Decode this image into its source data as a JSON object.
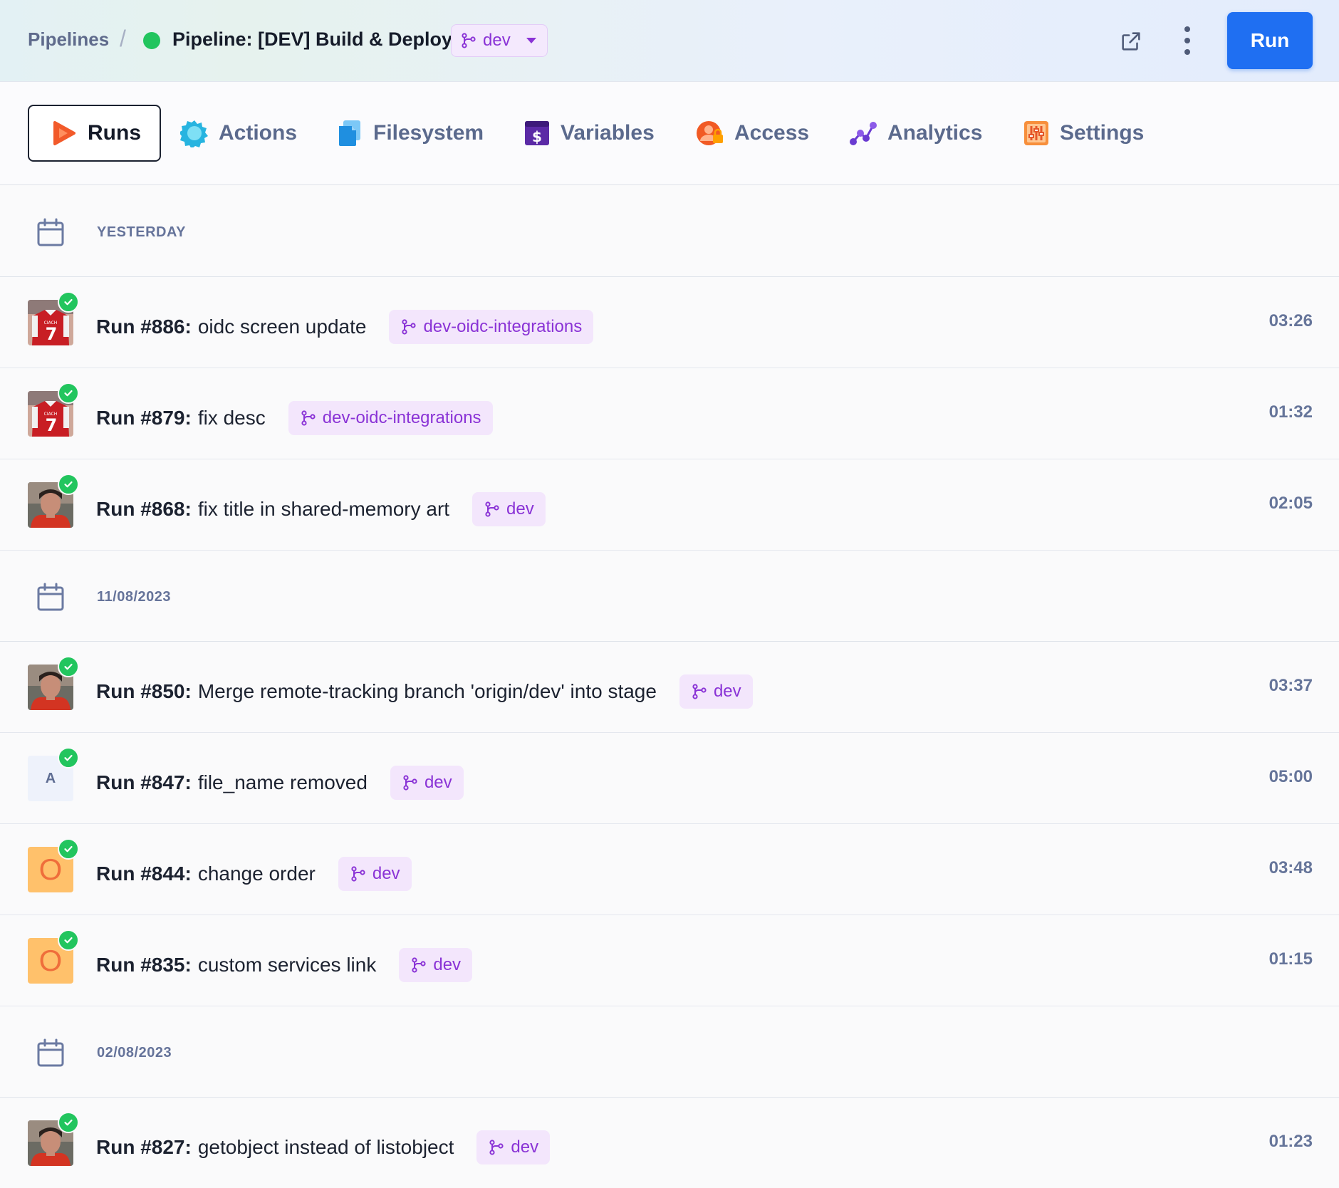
{
  "header": {
    "breadcrumb_root": "Pipelines",
    "breadcrumb_sep": "/",
    "pipeline_title": "Pipeline: [DEV] Build & Deploy",
    "status_color": "#22c55e",
    "branch": "dev",
    "run_button": "Run",
    "icons": [
      "external-link-icon",
      "kebab-menu-icon"
    ]
  },
  "tabs": [
    {
      "label": "Runs",
      "icon": "play-icon",
      "active": true
    },
    {
      "label": "Actions",
      "icon": "gear-icon",
      "active": false
    },
    {
      "label": "Filesystem",
      "icon": "files-icon",
      "active": false
    },
    {
      "label": "Variables",
      "icon": "dollar-icon",
      "active": false
    },
    {
      "label": "Access",
      "icon": "user-lock-icon",
      "active": false
    },
    {
      "label": "Analytics",
      "icon": "analytics-icon",
      "active": false
    },
    {
      "label": "Settings",
      "icon": "sliders-icon",
      "active": false
    }
  ],
  "groups": [
    {
      "date": "YESTERDAY",
      "runs": [
        {
          "num": "Run #886:",
          "message": "oidc screen update",
          "branch": "dev-oidc-integrations",
          "duration": "03:26",
          "avatar": "jersey"
        },
        {
          "num": "Run #879:",
          "message": "fix desc",
          "branch": "dev-oidc-integrations",
          "duration": "01:32",
          "avatar": "jersey"
        },
        {
          "num": "Run #868:",
          "message": "fix title in shared-memory art",
          "branch": "dev",
          "duration": "02:05",
          "avatar": "person"
        }
      ]
    },
    {
      "date": "11/08/2023",
      "runs": [
        {
          "num": "Run #850:",
          "message": "Merge remote-tracking branch 'origin/dev' into stage",
          "branch": "dev",
          "duration": "03:37",
          "avatar": "person"
        },
        {
          "num": "Run #847:",
          "message": "file_name removed",
          "branch": "dev",
          "duration": "05:00",
          "avatar": "letter",
          "avatar_letter": "A"
        },
        {
          "num": "Run #844:",
          "message": "change order",
          "branch": "dev",
          "duration": "03:48",
          "avatar": "letter-o",
          "avatar_letter": "O"
        },
        {
          "num": "Run #835:",
          "message": "custom services link",
          "branch": "dev",
          "duration": "01:15",
          "avatar": "letter-o",
          "avatar_letter": "O"
        }
      ]
    },
    {
      "date": "02/08/2023",
      "runs": [
        {
          "num": "Run #827:",
          "message": "getobject instead of listobject",
          "branch": "dev",
          "duration": "01:23",
          "avatar": "person"
        }
      ]
    }
  ],
  "colors": {
    "accent": "#1f6ff2",
    "branch_bg": "#f3e6fc",
    "branch_text": "#8a33d6",
    "success": "#22c55e"
  }
}
